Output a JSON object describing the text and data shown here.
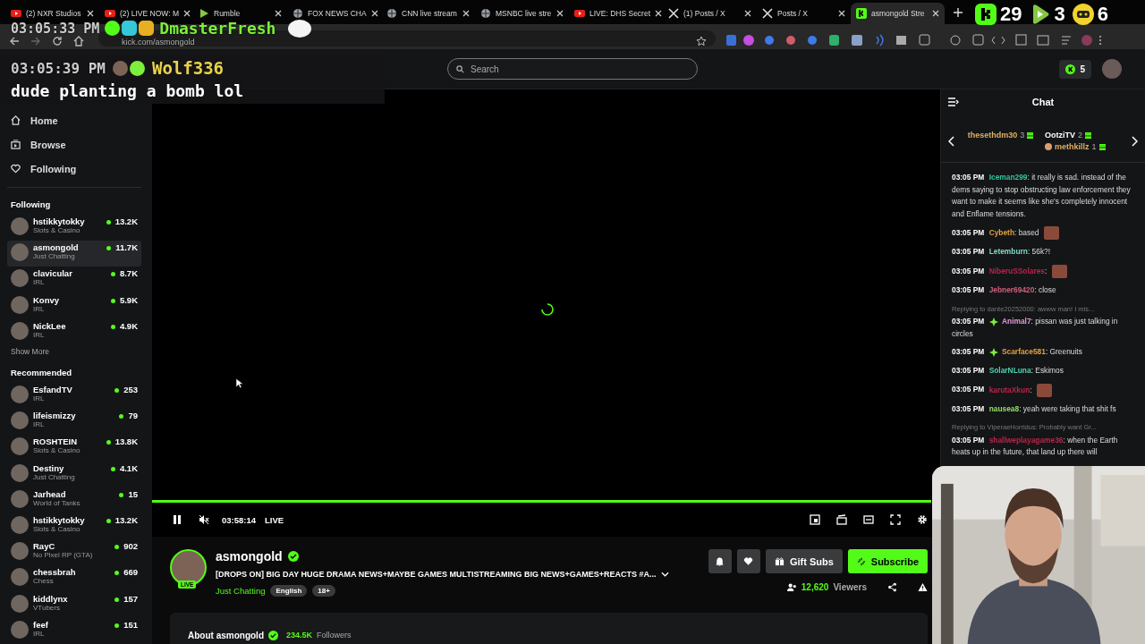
{
  "browser": {
    "tabs": [
      {
        "title": "(2) NXR Studios",
        "kind": "youtube",
        "selected": false
      },
      {
        "title": "(2) LIVE NOW: M",
        "kind": "youtube",
        "selected": false
      },
      {
        "title": "Rumble",
        "kind": "rumble",
        "selected": false
      },
      {
        "title": "FOX NEWS CHA",
        "kind": "globe",
        "selected": false
      },
      {
        "title": "CNN live stream",
        "kind": "globe",
        "selected": false
      },
      {
        "title": "MSNBC live stre",
        "kind": "globe",
        "selected": false
      },
      {
        "title": "LIVE: DHS Secret",
        "kind": "youtube",
        "selected": false
      },
      {
        "title": "(1) Posts / X",
        "kind": "x",
        "selected": false
      },
      {
        "title": "Posts / X",
        "kind": "x",
        "selected": false
      },
      {
        "title": "asmongold Stre",
        "kind": "kick",
        "selected": true
      }
    ],
    "url": "kick.com/asmongold"
  },
  "stream_overlay": {
    "clock_top": "03:05:33 PM",
    "user_top": "DmasterFresh",
    "clock": "03:05:39 PM",
    "user": "Wolf336",
    "message": "dude planting a bomb lol",
    "counters": [
      {
        "kind": "kick",
        "value": "29"
      },
      {
        "kind": "rumble",
        "value": "3"
      },
      {
        "kind": "controller",
        "value": "6"
      }
    ]
  },
  "header": {
    "search_placeholder": "Search",
    "points": "5"
  },
  "sidebar": {
    "nav": [
      {
        "label": "Home",
        "kind": "home"
      },
      {
        "label": "Browse",
        "kind": "browse"
      },
      {
        "label": "Following",
        "kind": "heart"
      }
    ],
    "following_title": "Following",
    "following": [
      {
        "name": "hstikkytokky",
        "category": "Slots & Casino",
        "viewers": "13.2K",
        "selected": false
      },
      {
        "name": "asmongold",
        "category": "Just Chatting",
        "viewers": "11.7K",
        "selected": true
      },
      {
        "name": "clavicular",
        "category": "IRL",
        "viewers": "8.7K",
        "selected": false
      },
      {
        "name": "Konvy",
        "category": "IRL",
        "viewers": "5.9K",
        "selected": false
      },
      {
        "name": "NickLee",
        "category": "IRL",
        "viewers": "4.9K",
        "selected": false
      }
    ],
    "show_more": "Show More",
    "recommended_title": "Recommended",
    "recommended": [
      {
        "name": "EsfandTV",
        "category": "IRL",
        "viewers": "253",
        "selected": false
      },
      {
        "name": "lifeismizzy",
        "category": "IRL",
        "viewers": "79",
        "selected": false
      },
      {
        "name": "ROSHTEIN",
        "category": "Slots & Casino",
        "viewers": "13.8K",
        "selected": false
      },
      {
        "name": "Destiny",
        "category": "Just Chatting",
        "viewers": "4.1K",
        "selected": false
      },
      {
        "name": "Jarhead",
        "category": "World of Tanks",
        "viewers": "15",
        "selected": false
      },
      {
        "name": "hstikkytokky",
        "category": "Slots & Casino",
        "viewers": "13.2K",
        "selected": false
      },
      {
        "name": "RayC",
        "category": "No Pixel RP (GTA)",
        "viewers": "902",
        "selected": false
      },
      {
        "name": "chessbrah",
        "category": "Chess",
        "viewers": "669",
        "selected": false
      },
      {
        "name": "kiddlynx",
        "category": "VTubers",
        "viewers": "157",
        "selected": false
      },
      {
        "name": "feef",
        "category": "IRL",
        "viewers": "151",
        "selected": false
      }
    ]
  },
  "player": {
    "time": "03:58:14",
    "live": "LIVE"
  },
  "stream": {
    "channel": "asmongold",
    "live_badge": "LIVE",
    "title": "[DROPS ON] BIG DAY HUGE DRAMA NEWS+MAYBE GAMES MULTISTREAMING BIG NEWS+GAMES+REACTS #A...",
    "category": "Just Chatting",
    "tags": [
      "English",
      "18+"
    ],
    "gift": "Gift Subs",
    "subscribe": "Subscribe",
    "viewers": "12,620",
    "viewers_label": "Viewers",
    "about": "About asmongold",
    "followers": "234.5K",
    "followers_label": "Followers"
  },
  "chat": {
    "title": "Chat",
    "leaderboard": [
      {
        "name": "thesethdm30",
        "count": "3"
      },
      {
        "name": "OotziTV",
        "count": "2"
      },
      {
        "name": "methkillz",
        "count": "1"
      }
    ],
    "messages": [
      {
        "time": "03:05 PM",
        "user": "Iceman299",
        "color": "#2fc49c",
        "text": ": it really is sad. instead of the dems saying to stop obstructing law enforcement they want to make it seems like she's completely innocent and Enflame tensions.",
        "badge": false,
        "emote": false
      },
      {
        "time": "03:05 PM",
        "user": "Cybeth",
        "color": "#e0a040",
        "text": ": based",
        "badge": false,
        "emote": true
      },
      {
        "time": "03:05 PM",
        "user": "Letemburn",
        "color": "#7fd8c4",
        "text": ": 56k?!",
        "badge": false,
        "emote": false
      },
      {
        "time": "03:05 PM",
        "user": "NiberuSSolares",
        "color": "#b8254a",
        "text": ":",
        "badge": false,
        "emote": true
      },
      {
        "time": "03:05 PM",
        "user": "Jebner69420",
        "color": "#d0607a",
        "text": ": close",
        "badge": false,
        "emote": false
      },
      {
        "time": "03:05 PM",
        "user": "Animal7",
        "color": "#e39ad6",
        "text": ": pissan was just talking in circles",
        "badge": true,
        "emote": false,
        "reply": "Replying to dante20252000: awww man! I mis..."
      },
      {
        "time": "03:05 PM",
        "user": "Scarface581",
        "color": "#e0a040",
        "text": ": Greenuits",
        "badge": true,
        "emote": false
      },
      {
        "time": "03:05 PM",
        "user": "SolarNLuna",
        "color": "#4fd0b0",
        "text": ": Eskimos",
        "badge": false,
        "emote": false
      },
      {
        "time": "03:05 PM",
        "user": "karutaXkun",
        "color": "#b8254a",
        "text": ":",
        "badge": false,
        "emote": true
      },
      {
        "time": "03:05 PM",
        "user": "nausea8",
        "color": "#8fe060",
        "text": ": yeah were taking that shit fs",
        "badge": false,
        "emote": false
      },
      {
        "time": "03:05 PM",
        "user": "shallweplayagame36",
        "color": "#b8254a",
        "text": ": when the Earth heats up in the future, that land up there will",
        "badge": false,
        "emote": false,
        "reply": "Replying to ViperaeHorridus: Probably want Gr..."
      }
    ]
  }
}
